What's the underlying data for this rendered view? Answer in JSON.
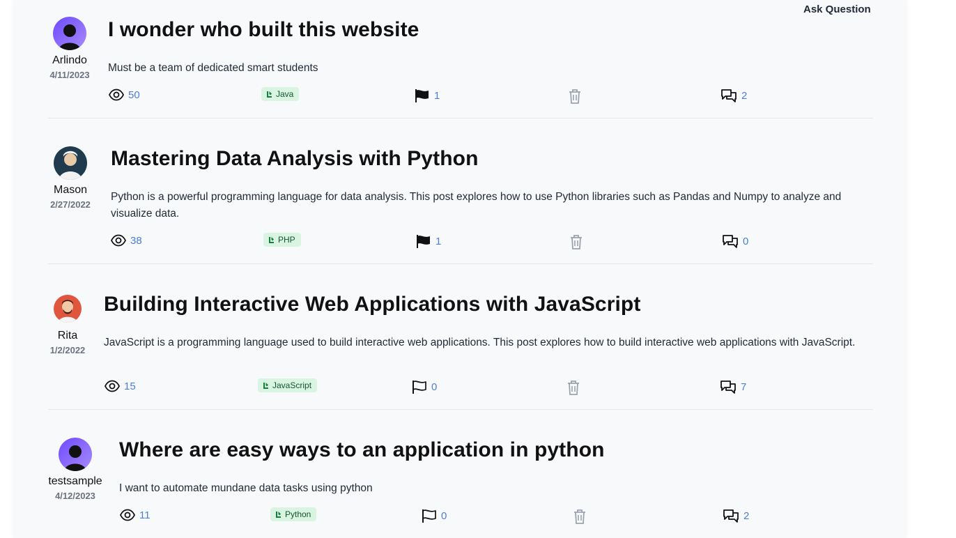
{
  "ask_button": "Ask Question",
  "posts": [
    {
      "author": "Arlindo",
      "date": "4/11/2023",
      "title": "I wonder who built this website",
      "body": "Must be a team of dedicated smart students",
      "views": "50",
      "tag": "Java",
      "flags": "1",
      "comments": "2",
      "flagged": true
    },
    {
      "author": "Mason",
      "date": "2/27/2022",
      "title": "Mastering Data Analysis with Python",
      "body": "Python is a powerful programming language for data analysis. This post explores how to use Python libraries such as Pandas and Numpy to analyze and visualize data.",
      "views": "38",
      "tag": "PHP",
      "flags": "1",
      "comments": "0",
      "flagged": true
    },
    {
      "author": "Rita",
      "date": "1/2/2022",
      "title": "Building Interactive Web Applications with JavaScript",
      "body": "JavaScript is a programming language used to build interactive web applications. This post explores how to build interactive web applications with JavaScript.",
      "views": "15",
      "tag": "JavaScript",
      "flags": "0",
      "comments": "7",
      "flagged": false
    },
    {
      "author": "testsample",
      "date": "4/12/2023",
      "title": "Where are easy ways to an application in python",
      "body": "I want to automate mundane data tasks using python",
      "views": "11",
      "tag": "Python",
      "flags": "0",
      "comments": "2",
      "flagged": false
    }
  ]
}
